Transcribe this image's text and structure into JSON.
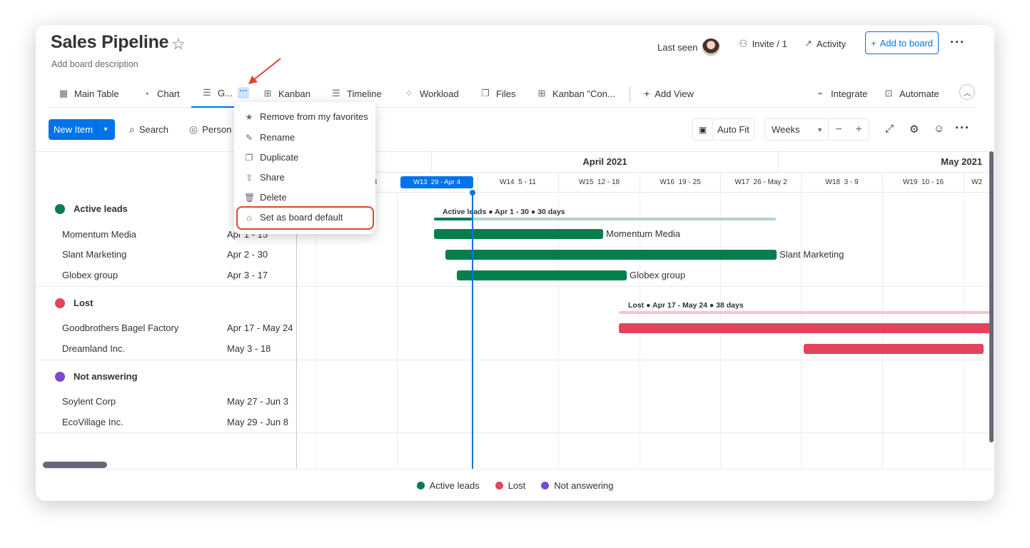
{
  "board": {
    "title": "Sales Pipeline",
    "description": "Add board description",
    "last_seen": "Last seen",
    "invite": "Invite / 1",
    "activity": "Activity",
    "add_to_board": "Add to board"
  },
  "tabs": [
    {
      "label": "Main Table",
      "icon": "table-icon"
    },
    {
      "label": "Chart",
      "icon": "chart-icon"
    },
    {
      "label": "G...",
      "icon": "gantt-icon"
    },
    {
      "label": "Kanban",
      "icon": "kanban-icon"
    },
    {
      "label": "Timeline",
      "icon": "timeline-icon"
    },
    {
      "label": "Workload",
      "icon": "workload-icon"
    },
    {
      "label": "Files",
      "icon": "files-icon"
    },
    {
      "label": "Kanban \"Con...",
      "icon": "kanban-icon"
    },
    {
      "label": "Add View",
      "icon": "plus-icon"
    }
  ],
  "tab_actions": {
    "integrate": "Integrate",
    "automate": "Automate"
  },
  "toolbar": {
    "new_item": "New Item",
    "search": "Search",
    "person": "Person",
    "auto_fit": "Auto Fit",
    "zoom_select": "Weeks"
  },
  "timeline": {
    "months": [
      "April 2021",
      "May 2021"
    ],
    "weeks": [
      "W13  29 - Apr 4",
      "W14  5 - 11",
      "W15  12 - 18",
      "W16  19 - 25",
      "W17  26 - May 2",
      "W18  3 - 9",
      "W19  10 - 16"
    ]
  },
  "groups": [
    {
      "name": "Active leads",
      "color": "#037f4c",
      "summary": "Active leads ● Apr 1 - 30 ● 30 days",
      "items": [
        {
          "name": "Momentum Media",
          "dates": "Apr 1 - 15"
        },
        {
          "name": "Slant Marketing",
          "dates": "Apr 2 - 30"
        },
        {
          "name": "Globex group",
          "dates": "Apr 3 - 17"
        }
      ]
    },
    {
      "name": "Lost",
      "color": "#e2445c",
      "summary": "Lost ● Apr 17 - May 24 ● 38 days",
      "items": [
        {
          "name": "Goodbrothers Bagel Factory",
          "dates": "Apr 17 - May 24"
        },
        {
          "name": "Dreamland Inc.",
          "dates": "May 3 - 18"
        }
      ]
    },
    {
      "name": "Not answering",
      "color": "#784bd1",
      "items": [
        {
          "name": "Soylent Corp",
          "dates": "May 27 - Jun 3"
        },
        {
          "name": "EcoVillage Inc.",
          "dates": "May 29 - Jun 8"
        }
      ]
    }
  ],
  "context_menu": [
    {
      "label": "Remove from my favorites",
      "icon": "star-icon"
    },
    {
      "label": "Rename",
      "icon": "pencil-icon"
    },
    {
      "label": "Duplicate",
      "icon": "duplicate-icon"
    },
    {
      "label": "Share",
      "icon": "share-icon"
    },
    {
      "label": "Delete",
      "icon": "trash-icon"
    },
    {
      "label": "Set as board default",
      "icon": "home-icon"
    }
  ],
  "legend": [
    "Active leads",
    "Lost",
    "Not answering"
  ]
}
